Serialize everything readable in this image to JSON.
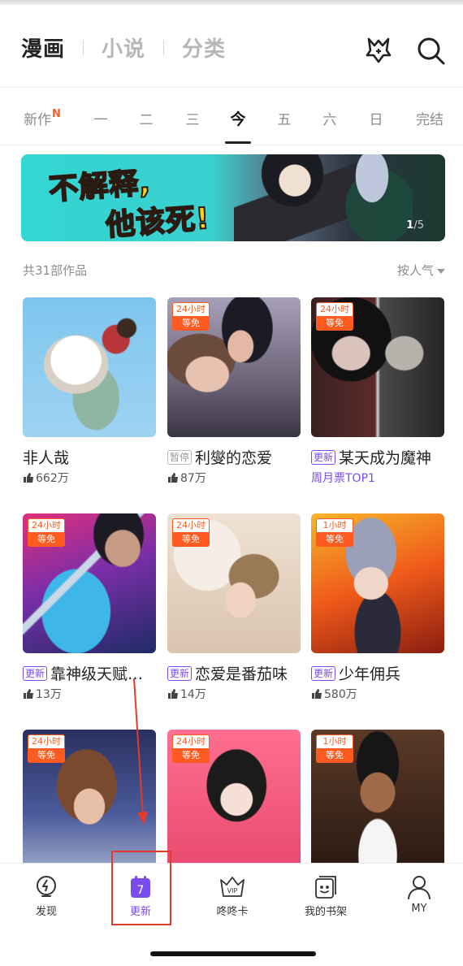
{
  "top_tabs": [
    "漫画",
    "小说",
    "分类"
  ],
  "day_tabs": [
    {
      "label": "新作",
      "badge": "N"
    },
    {
      "label": "一"
    },
    {
      "label": "二"
    },
    {
      "label": "三"
    },
    {
      "label": "今",
      "active": true
    },
    {
      "label": "五"
    },
    {
      "label": "六"
    },
    {
      "label": "日"
    },
    {
      "label": "完结"
    }
  ],
  "banner": {
    "line1": "不解释,",
    "line2": "他该死!",
    "page_current": "1",
    "page_total": "/5"
  },
  "list_header": {
    "count": "共31部作品",
    "sort": "按人气"
  },
  "cards": [
    {
      "title": "非人哉",
      "meta": "662万",
      "meta_kind": "likes",
      "badge": null,
      "tag": null
    },
    {
      "title": "利燮的恋爱",
      "meta": "87万",
      "meta_kind": "likes",
      "badge": [
        "24小时",
        "等免"
      ],
      "tag": "暂停"
    },
    {
      "title": "某天成为魔神",
      "meta": "周月票TOP1",
      "meta_kind": "rank",
      "badge": [
        "24小时",
        "等免"
      ],
      "tag": "更新"
    },
    {
      "title": "靠神级天赋…",
      "meta": "13万",
      "meta_kind": "likes",
      "badge": [
        "24小时",
        "等免"
      ],
      "tag": "更新"
    },
    {
      "title": "恋爱是番茄味",
      "meta": "14万",
      "meta_kind": "likes",
      "badge": [
        "24小时",
        "等免"
      ],
      "tag": "更新"
    },
    {
      "title": "少年佣兵",
      "meta": "580万",
      "meta_kind": "likes",
      "badge": [
        "1小时",
        "等免"
      ],
      "tag": "更新"
    },
    {
      "title": "",
      "meta": "",
      "meta_kind": "likes",
      "badge": [
        "24小时",
        "等免"
      ],
      "tag": null
    },
    {
      "title": "",
      "meta": "",
      "meta_kind": "likes",
      "badge": [
        "24小时",
        "等免"
      ],
      "tag": null
    },
    {
      "title": "",
      "meta": "",
      "meta_kind": "likes",
      "badge": [
        "1小时",
        "等免"
      ],
      "tag": null
    }
  ],
  "bottom_nav": [
    {
      "label": "发现",
      "icon": "discover-icon"
    },
    {
      "label": "更新",
      "icon": "calendar-icon",
      "icon_text": "7",
      "active": true
    },
    {
      "label": "咚咚卡",
      "icon": "vip-crown-icon",
      "icon_text": "VIP"
    },
    {
      "label": "我的书架",
      "icon": "bookshelf-icon"
    },
    {
      "label": "MY",
      "icon": "user-icon"
    }
  ],
  "colors": {
    "accent": "#7a4cf0",
    "free_badge": "#ff5a1f",
    "annotation": "#e23a2b"
  }
}
